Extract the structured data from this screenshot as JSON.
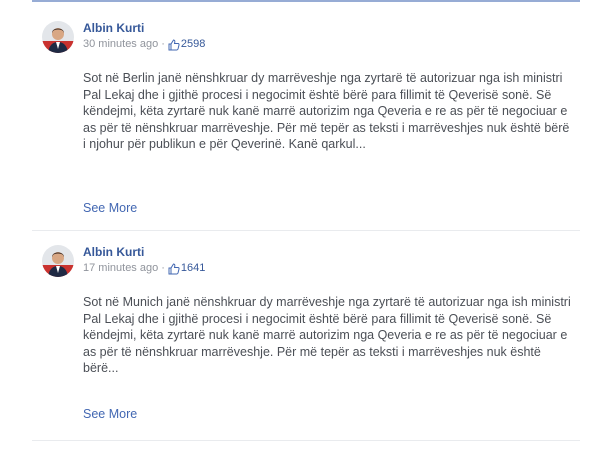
{
  "posts": [
    {
      "author": "Albin Kurti",
      "time": "30 minutes ago",
      "separator": "·",
      "likes": "2598",
      "text": "Sot në Berlin janë nënshkruar dy marrëveshje nga zyrtarë të autorizuar nga ish ministri Pal Lekaj dhe i gjithë procesi i negocimit është bërë para fillimit të Qeverisë sonë. Së këndejmi, këta zyrtarë nuk kanë marrë autorizim nga Qeveria e re as për të negociuar e as për të nënshkruar marrëveshje. Për më tepër as teksti i marrëveshjes nuk është bërë i njohur për publikun e për Qeverinë. Kanë qarkul...",
      "see_more": "See More"
    },
    {
      "author": "Albin Kurti",
      "time": "17 minutes ago",
      "separator": "·",
      "likes": "1641",
      "text": "Sot në Munich janë nënshkruar dy marrëveshje nga zyrtarë të autorizuar nga ish ministri Pal Lekaj dhe i gjithë procesi i negocimit është bërë para fillimit të Qeverisë sonë. Së këndejmi, këta zyrtarë nuk kanë marrë autorizim nga Qeveria e re as për të negociuar e as për të nënshkruar marrëveshje. Për më tepër as teksti i marrëveshjes nuk është bërë...",
      "see_more": "See More"
    }
  ],
  "icons": {
    "avatar": "profile-photo",
    "like": "thumbs-up-icon"
  },
  "colors": {
    "link": "#365899",
    "see_more": "#4267b2",
    "meta": "#90949c",
    "text": "#4b4f56"
  }
}
